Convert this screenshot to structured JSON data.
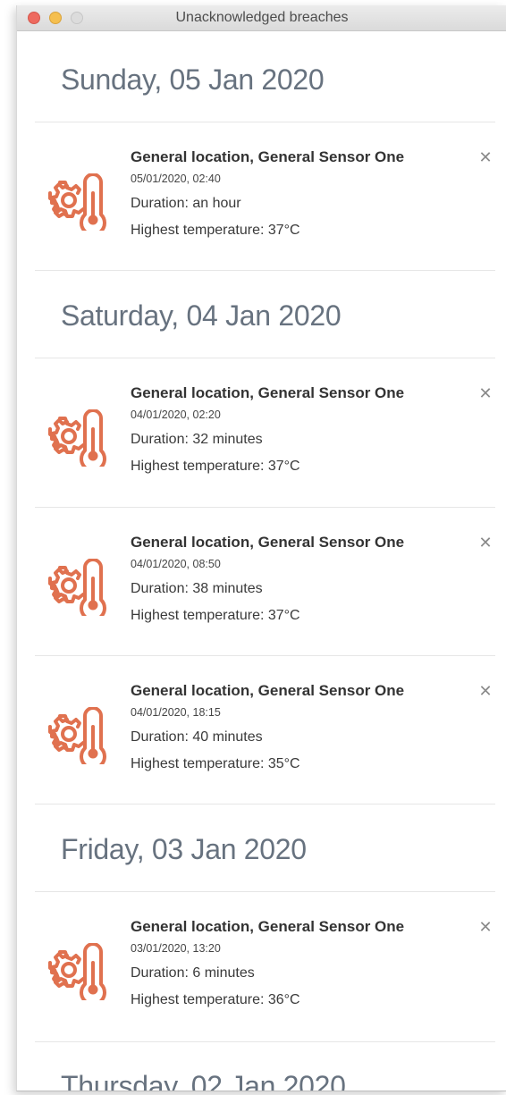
{
  "window": {
    "title": "Unacknowledged breaches"
  },
  "icons": {
    "dismiss_glyph": "✕",
    "breach_icon": "gear-thermometer-icon",
    "accent_color": "#e0714f"
  },
  "days": [
    {
      "heading": "Sunday, 05 Jan 2020",
      "entries": [
        {
          "title": "General location, General Sensor One",
          "timestamp": "05/01/2020, 02:40",
          "duration": "Duration: an hour",
          "highest_temp": "Highest temperature: 37°C"
        }
      ]
    },
    {
      "heading": "Saturday, 04 Jan 2020",
      "entries": [
        {
          "title": "General location, General Sensor One",
          "timestamp": "04/01/2020, 02:20",
          "duration": "Duration: 32 minutes",
          "highest_temp": "Highest temperature: 37°C"
        },
        {
          "title": "General location, General Sensor One",
          "timestamp": "04/01/2020, 08:50",
          "duration": "Duration: 38 minutes",
          "highest_temp": "Highest temperature: 37°C"
        },
        {
          "title": "General location, General Sensor One",
          "timestamp": "04/01/2020, 18:15",
          "duration": "Duration: 40 minutes",
          "highest_temp": "Highest temperature: 35°C"
        }
      ]
    },
    {
      "heading": "Friday, 03 Jan 2020",
      "entries": [
        {
          "title": "General location, General Sensor One",
          "timestamp": "03/01/2020, 13:20",
          "duration": "Duration: 6 minutes",
          "highest_temp": "Highest temperature: 36°C"
        }
      ]
    },
    {
      "heading": "Thursday, 02 Jan 2020",
      "entries": []
    }
  ]
}
